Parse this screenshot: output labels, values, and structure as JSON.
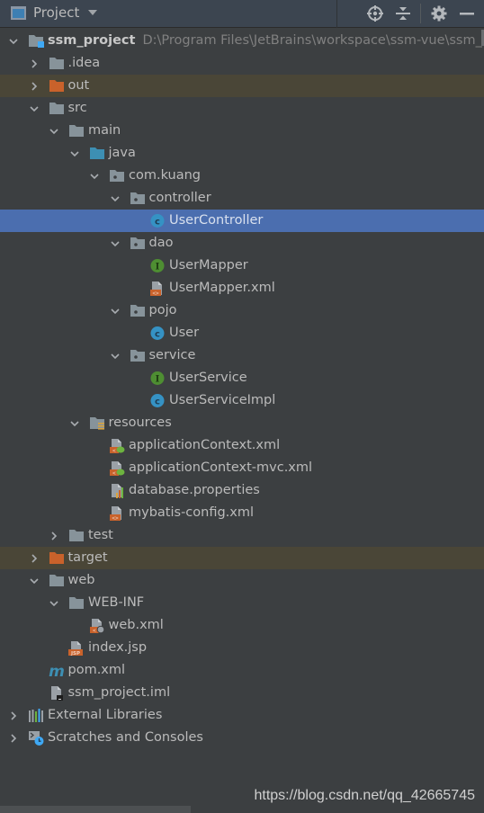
{
  "header": {
    "title": "Project",
    "tools": [
      "locate-icon",
      "collapse-all-icon",
      "gear-icon",
      "minimize-icon"
    ]
  },
  "tree": [
    {
      "label": "ssm_project",
      "path": "D:\\Program Files\\JetBrains\\workspace\\ssm-vue\\ssm_",
      "depth": 0,
      "arrow": "down",
      "icon": "module-folder",
      "bold": true
    },
    {
      "label": ".idea",
      "depth": 1,
      "arrow": "right",
      "icon": "folder"
    },
    {
      "label": "out",
      "depth": 1,
      "arrow": "right",
      "icon": "excluded-folder",
      "excluded": true
    },
    {
      "label": "src",
      "depth": 1,
      "arrow": "down",
      "icon": "folder"
    },
    {
      "label": "main",
      "depth": 2,
      "arrow": "down",
      "icon": "folder"
    },
    {
      "label": "java",
      "depth": 3,
      "arrow": "down",
      "icon": "source-folder"
    },
    {
      "label": "com.kuang",
      "depth": 4,
      "arrow": "down",
      "icon": "package"
    },
    {
      "label": "controller",
      "depth": 5,
      "arrow": "down",
      "icon": "package"
    },
    {
      "label": "UserController",
      "depth": 6,
      "arrow": "none",
      "icon": "class",
      "selected": true
    },
    {
      "label": "dao",
      "depth": 5,
      "arrow": "down",
      "icon": "package"
    },
    {
      "label": "UserMapper",
      "depth": 6,
      "arrow": "none",
      "icon": "interface"
    },
    {
      "label": "UserMapper.xml",
      "depth": 6,
      "arrow": "none",
      "icon": "xml-file"
    },
    {
      "label": "pojo",
      "depth": 5,
      "arrow": "down",
      "icon": "package"
    },
    {
      "label": "User",
      "depth": 6,
      "arrow": "none",
      "icon": "class"
    },
    {
      "label": "service",
      "depth": 5,
      "arrow": "down",
      "icon": "package"
    },
    {
      "label": "UserService",
      "depth": 6,
      "arrow": "none",
      "icon": "interface"
    },
    {
      "label": "UserServiceImpl",
      "depth": 6,
      "arrow": "none",
      "icon": "class"
    },
    {
      "label": "resources",
      "depth": 3,
      "arrow": "down",
      "icon": "resources-folder"
    },
    {
      "label": "applicationContext.xml",
      "depth": 4,
      "arrow": "none",
      "icon": "spring-xml-file"
    },
    {
      "label": "applicationContext-mvc.xml",
      "depth": 4,
      "arrow": "none",
      "icon": "spring-xml-file"
    },
    {
      "label": "database.properties",
      "depth": 4,
      "arrow": "none",
      "icon": "properties-file"
    },
    {
      "label": "mybatis-config.xml",
      "depth": 4,
      "arrow": "none",
      "icon": "xml-file"
    },
    {
      "label": "test",
      "depth": 2,
      "arrow": "right",
      "icon": "folder"
    },
    {
      "label": "target",
      "depth": 1,
      "arrow": "right",
      "icon": "excluded-folder",
      "excluded": true
    },
    {
      "label": "web",
      "depth": 1,
      "arrow": "down",
      "icon": "folder"
    },
    {
      "label": "WEB-INF",
      "depth": 2,
      "arrow": "down",
      "icon": "folder"
    },
    {
      "label": "web.xml",
      "depth": 3,
      "arrow": "none",
      "icon": "web-xml-file"
    },
    {
      "label": "index.jsp",
      "depth": 2,
      "arrow": "none",
      "icon": "jsp-file"
    },
    {
      "label": "pom.xml",
      "depth": 1,
      "arrow": "none",
      "icon": "maven-file"
    },
    {
      "label": "ssm_project.iml",
      "depth": 1,
      "arrow": "none",
      "icon": "iml-file"
    },
    {
      "label": "External Libraries",
      "depth": 0,
      "arrow": "right",
      "icon": "libraries"
    },
    {
      "label": "Scratches and Consoles",
      "depth": 0,
      "arrow": "right",
      "icon": "scratches"
    }
  ],
  "watermark": "https://blog.csdn.net/qq_42665745",
  "colors": {
    "background": "#3c3f41",
    "header": "#3c4550",
    "selected": "#4b6eaf",
    "excluded_row": "#4a4637",
    "folder": "#87939a",
    "excluded_folder": "#c9622b",
    "source_folder": "#3d8fb3",
    "class": "#3592c4",
    "interface": "#4e8e32"
  }
}
